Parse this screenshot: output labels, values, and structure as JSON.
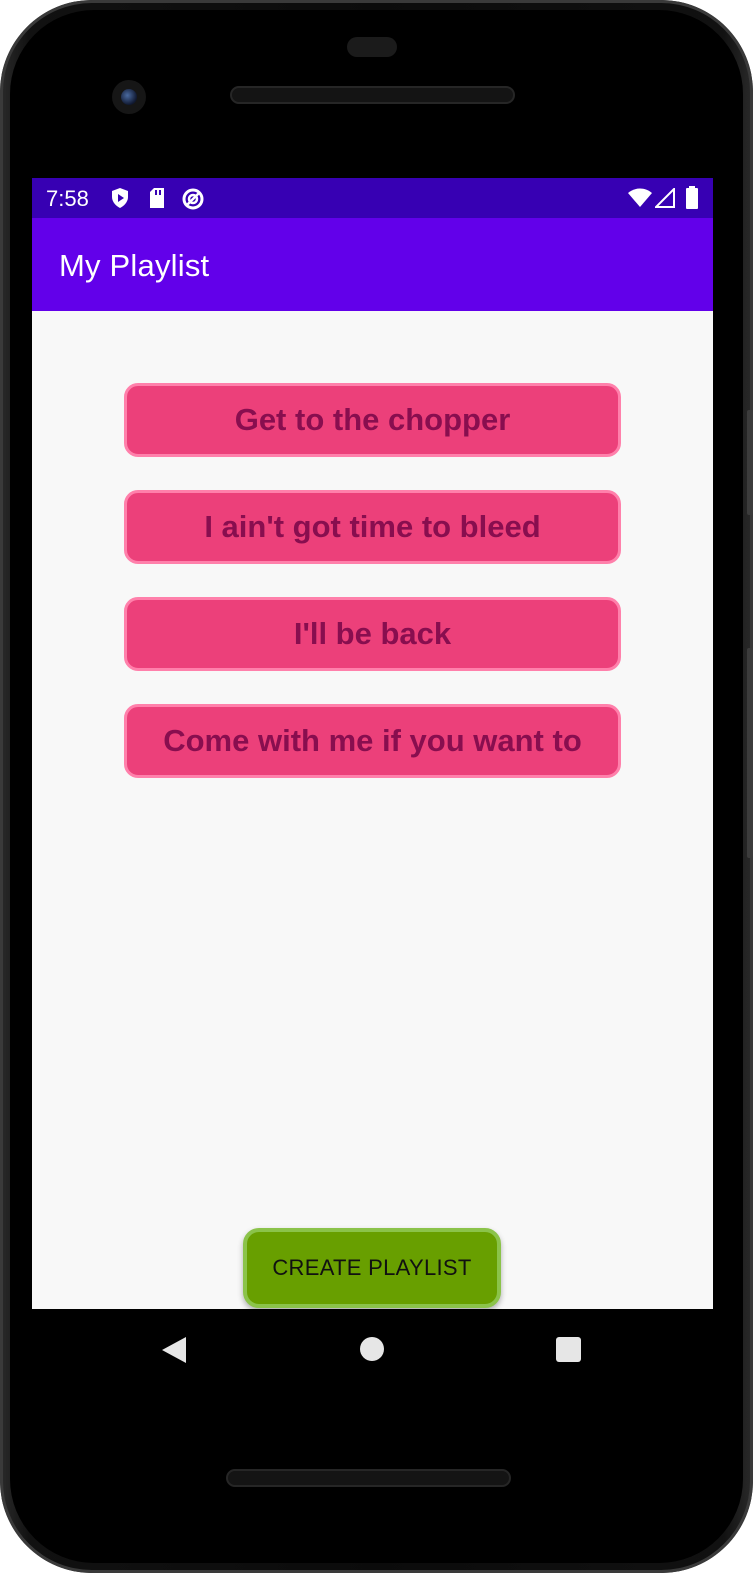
{
  "status_bar": {
    "time": "7:58",
    "left_icons": [
      "shield-play-icon",
      "sd-card-icon",
      "data-saver-icon"
    ],
    "right_icons": [
      "wifi-icon",
      "cellular-signal-icon",
      "battery-icon"
    ]
  },
  "app_bar": {
    "title": "My Playlist"
  },
  "songs": [
    {
      "label": "Get to the chopper"
    },
    {
      "label": "I ain't got time to bleed"
    },
    {
      "label": "I'll be back"
    },
    {
      "label": "Come with me if you want to"
    }
  ],
  "actions": {
    "create_label": "CREATE PLAYLIST"
  },
  "nav_bar": {
    "icons": [
      "back-icon",
      "home-icon",
      "recents-icon"
    ]
  },
  "colors": {
    "status_bar": "#3700b3",
    "app_bar": "#6200ea",
    "song_button": "#ec407a",
    "song_button_border": "#ff80ab",
    "song_text": "#880e4f",
    "create_button": "#689f00",
    "create_button_border": "#8bc34a",
    "background": "#f8f8f8"
  }
}
